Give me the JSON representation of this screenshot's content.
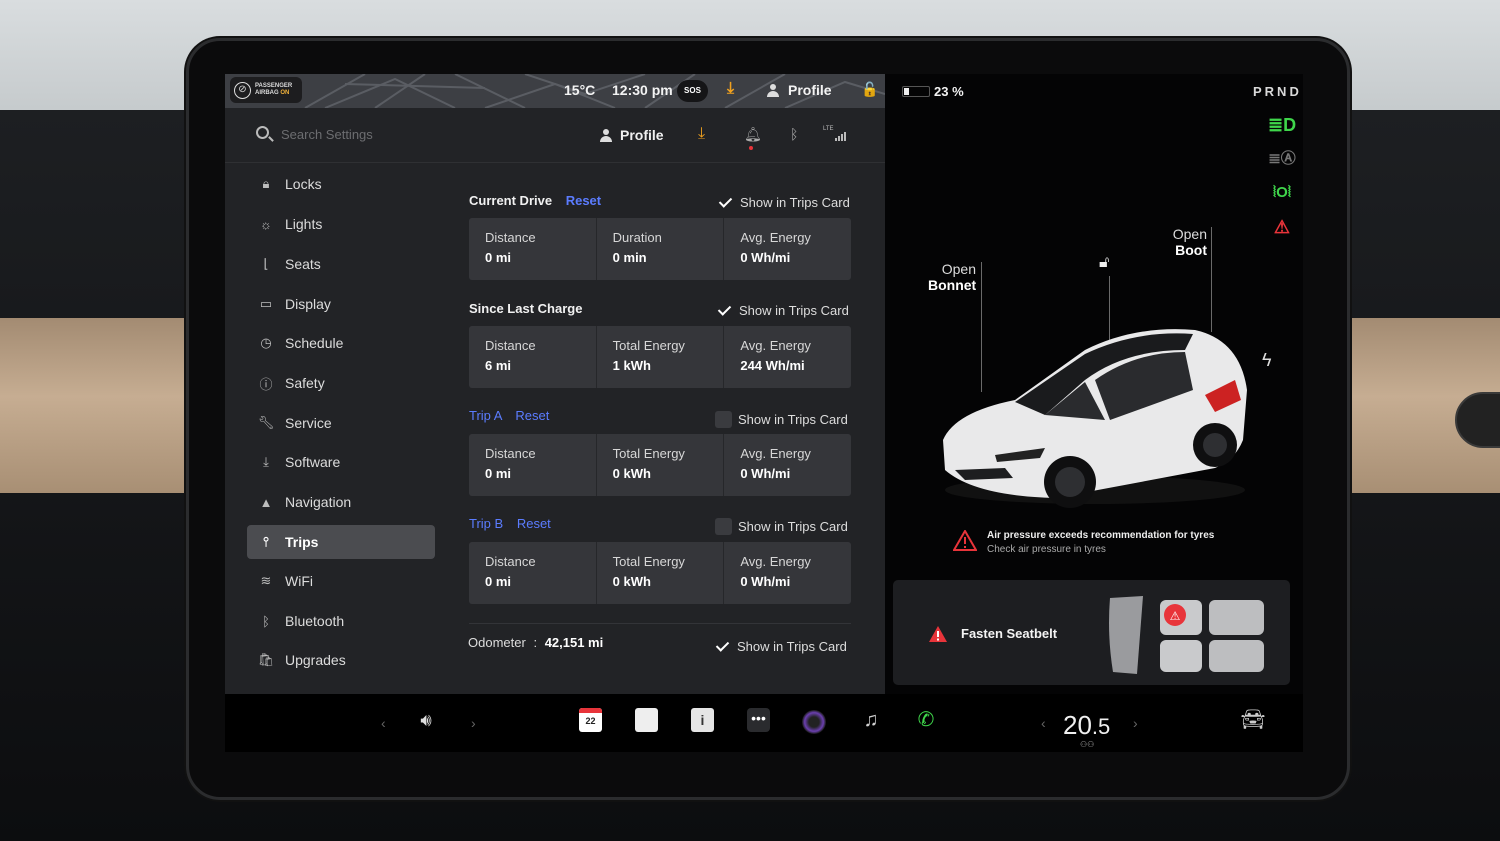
{
  "status_bar": {
    "airbag_line1": "PASSENGER",
    "airbag_line2": "AIRBAG",
    "airbag_state": "ON",
    "temperature": "15°C",
    "time": "12:30 pm",
    "sos": "SOS",
    "profile": "Profile",
    "battery_percent": "23 %",
    "gear": "PRND"
  },
  "settings_header": {
    "search_placeholder": "Search Settings",
    "profile": "Profile",
    "lte": "LTE"
  },
  "sidebar": {
    "items": [
      {
        "label": "Locks",
        "icon": "lock-icon"
      },
      {
        "label": "Lights",
        "icon": "light-icon"
      },
      {
        "label": "Seats",
        "icon": "seat-icon"
      },
      {
        "label": "Display",
        "icon": "display-icon"
      },
      {
        "label": "Schedule",
        "icon": "schedule-icon"
      },
      {
        "label": "Safety",
        "icon": "safety-icon"
      },
      {
        "label": "Service",
        "icon": "wrench-icon"
      },
      {
        "label": "Software",
        "icon": "download-icon"
      },
      {
        "label": "Navigation",
        "icon": "navigation-icon"
      },
      {
        "label": "Trips",
        "icon": "trips-icon",
        "active": true
      },
      {
        "label": "WiFi",
        "icon": "wifi-icon"
      },
      {
        "label": "Bluetooth",
        "icon": "bluetooth-icon"
      },
      {
        "label": "Upgrades",
        "icon": "upgrades-icon"
      }
    ]
  },
  "trips": {
    "current_drive": {
      "title": "Current Drive",
      "reset": "Reset",
      "show_label": "Show in Trips Card",
      "checked": true,
      "cells": [
        {
          "label": "Distance",
          "value": "0 mi"
        },
        {
          "label": "Duration",
          "value": "0 min"
        },
        {
          "label": "Avg. Energy",
          "value": "0 Wh/mi"
        }
      ]
    },
    "since_last_charge": {
      "title": "Since Last Charge",
      "show_label": "Show in Trips Card",
      "checked": true,
      "cells": [
        {
          "label": "Distance",
          "value": "6 mi"
        },
        {
          "label": "Total Energy",
          "value": "1 kWh"
        },
        {
          "label": "Avg. Energy",
          "value": "244 Wh/mi"
        }
      ]
    },
    "trip_a": {
      "title": "Trip A",
      "reset": "Reset",
      "show_label": "Show in Trips Card",
      "checked": false,
      "cells": [
        {
          "label": "Distance",
          "value": "0 mi"
        },
        {
          "label": "Total Energy",
          "value": "0 kWh"
        },
        {
          "label": "Avg. Energy",
          "value": "0 Wh/mi"
        }
      ]
    },
    "trip_b": {
      "title": "Trip B",
      "reset": "Reset",
      "show_label": "Show in Trips Card",
      "checked": false,
      "cells": [
        {
          "label": "Distance",
          "value": "0 mi"
        },
        {
          "label": "Total Energy",
          "value": "0 kWh"
        },
        {
          "label": "Avg. Energy",
          "value": "0 Wh/mi"
        }
      ]
    },
    "odometer": {
      "label": "Odometer",
      "separator": ":",
      "value": "42,151 mi",
      "show_label": "Show in Trips Card",
      "checked": true
    }
  },
  "vehicle": {
    "bonnet_line1": "Open",
    "bonnet_line2": "Bonnet",
    "boot_line1": "Open",
    "boot_line2": "Boot",
    "warning_title": "Air pressure exceeds recommendation for tyres",
    "warning_sub": "Check air pressure in tyres",
    "seatbelt": "Fasten Seatbelt"
  },
  "dock": {
    "calendar_day": "22",
    "temp_whole": "20",
    "temp_decimal": ".5"
  },
  "colors": {
    "accent_blue": "#5b7cff",
    "indicator_green": "#3fd64b",
    "alert_red": "#e8343a",
    "download_orange": "#f0a11f"
  }
}
